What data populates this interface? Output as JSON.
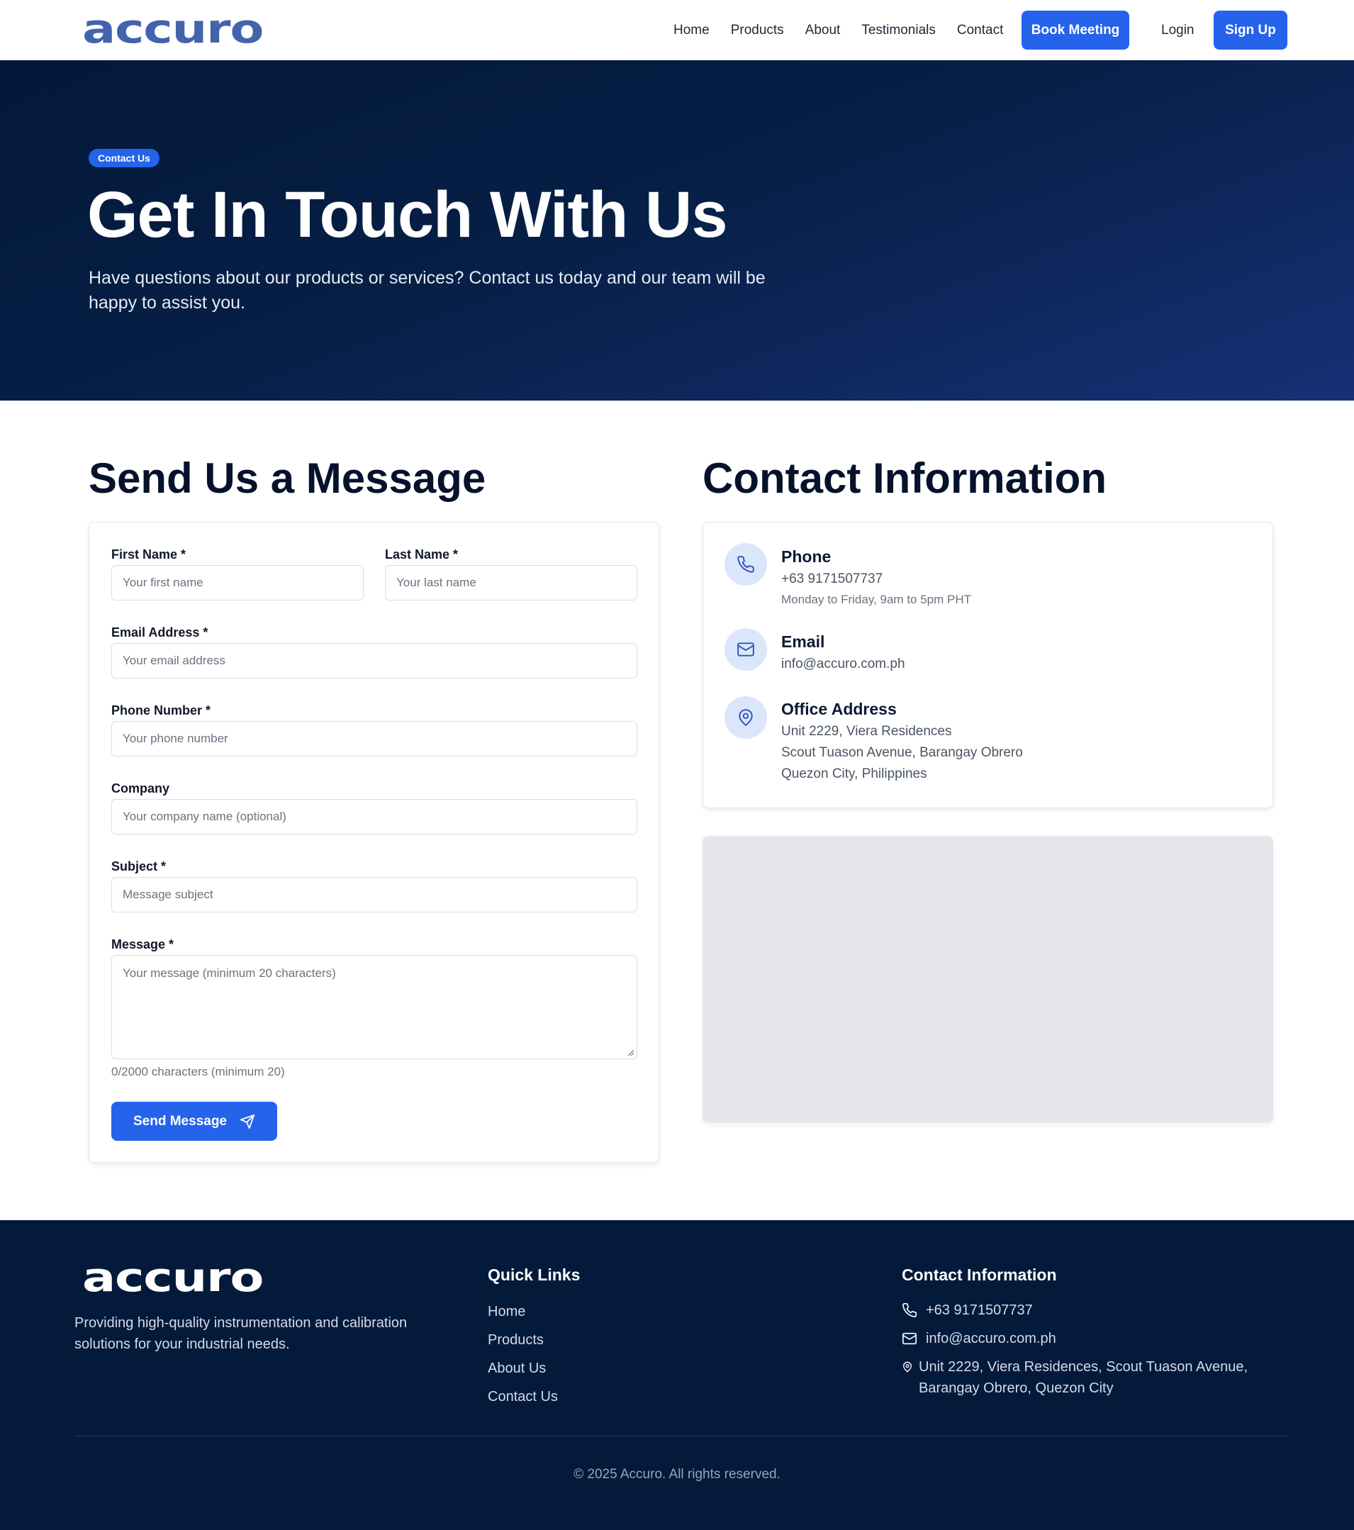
{
  "nav": {
    "logo": "accuro",
    "links": [
      "Home",
      "Products",
      "About",
      "Testimonials",
      "Contact"
    ],
    "book_meeting": "Book Meeting",
    "login": "Login",
    "sign_up": "Sign Up"
  },
  "hero": {
    "badge": "Contact Us",
    "title": "Get In Touch With Us",
    "subtitle": "Have questions about our products or services? Contact us today and our team will be happy to assist you."
  },
  "form": {
    "title": "Send Us a Message",
    "first_name": {
      "label": "First Name *",
      "placeholder": "Your first name",
      "value": ""
    },
    "last_name": {
      "label": "Last Name *",
      "placeholder": "Your last name",
      "value": ""
    },
    "email": {
      "label": "Email Address *",
      "placeholder": "Your email address",
      "value": ""
    },
    "phone": {
      "label": "Phone Number *",
      "placeholder": "Your phone number",
      "value": ""
    },
    "company": {
      "label": "Company",
      "placeholder": "Your company name (optional)",
      "value": ""
    },
    "subject": {
      "label": "Subject *",
      "placeholder": "Message subject",
      "value": ""
    },
    "message": {
      "label": "Message *",
      "placeholder": "Your message (minimum 20 characters)",
      "value": ""
    },
    "char_count": "0/2000 characters (minimum 20)",
    "submit": "Send Message"
  },
  "contact": {
    "title": "Contact Information",
    "phone": {
      "heading": "Phone",
      "value": "+63 9171507737",
      "note": "Monday to Friday, 9am to 5pm PHT"
    },
    "email": {
      "heading": "Email",
      "value": "info@accuro.com.ph"
    },
    "address": {
      "heading": "Office Address",
      "line1": "Unit 2229, Viera Residences",
      "line2": "Scout Tuason Avenue, Barangay Obrero",
      "line3": "Quezon City, Philippines"
    }
  },
  "footer": {
    "logo": "accuro",
    "description": "Providing high-quality instrumentation and calibration solutions for your industrial needs.",
    "quick_links_title": "Quick Links",
    "quick_links": [
      "Home",
      "Products",
      "About Us",
      "Contact Us"
    ],
    "contact_title": "Contact Information",
    "phone": "+63 9171507737",
    "email": "info@accuro.com.ph",
    "address": "Unit 2229, Viera Residences, Scout Tuason Avenue, Barangay Obrero, Quezon City",
    "copyright": "© 2025 Accuro. All rights reserved."
  },
  "colors": {
    "accent": "#2563eb",
    "logo_blue": "#4463ad",
    "hero_dark": "#03183a",
    "footer_bg": "#041a3b",
    "map_placeholder": "#e5e7eb"
  },
  "icons": [
    "phone-icon",
    "mail-icon",
    "map-pin-icon",
    "send-icon"
  ]
}
